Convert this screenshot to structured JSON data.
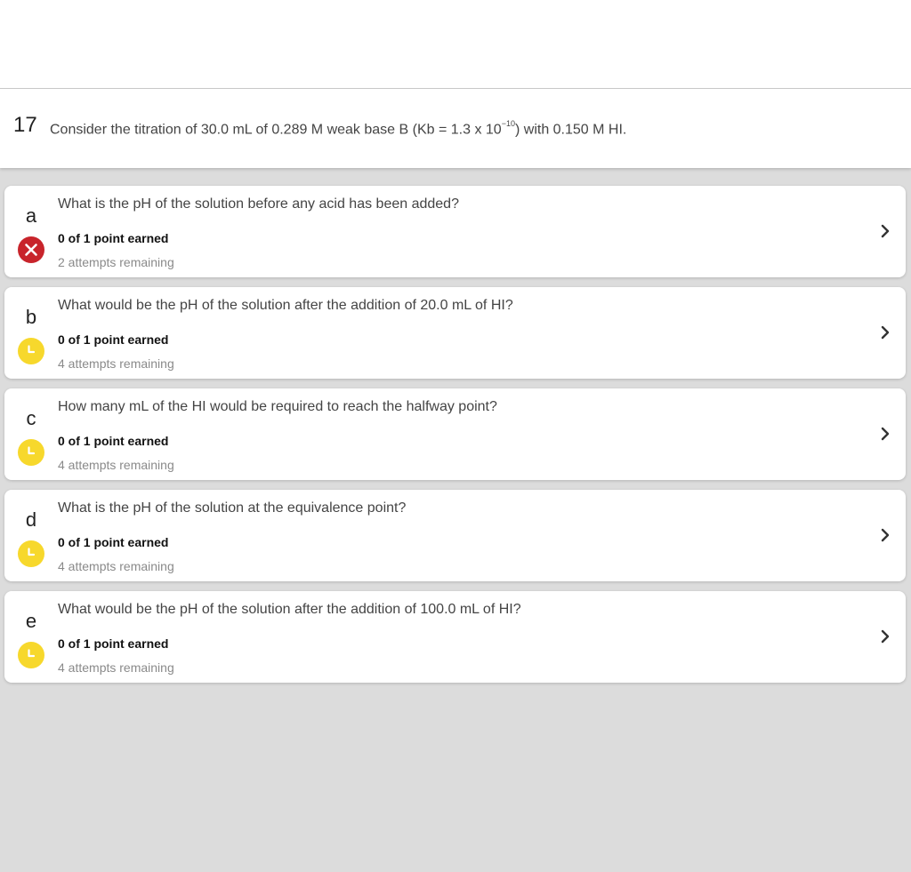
{
  "question": {
    "number": "17",
    "text_before": "Consider the titration of 30.0 mL of 0.289 M weak base B (Kb = 1.3 x 10",
    "exponent": "−10",
    "text_after": ") with 0.150 M HI."
  },
  "parts": [
    {
      "letter": "a",
      "question": "What is the pH of the solution before any acid has been added?",
      "points": "0 of 1 point earned",
      "attempts": "2 attempts remaining",
      "status_icon": "x-icon",
      "status_color": "#c8242b"
    },
    {
      "letter": "b",
      "question": "What would be the pH of the solution after the addition of 20.0 mL of HI?",
      "points": "0 of 1 point earned",
      "attempts": "4 attempts remaining",
      "status_icon": "clock-icon",
      "status_color": "#f7d82c"
    },
    {
      "letter": "c",
      "question": "How many mL of the HI would be required to reach the halfway point?",
      "points": "0 of 1 point earned",
      "attempts": "4 attempts remaining",
      "status_icon": "clock-icon",
      "status_color": "#f7d82c"
    },
    {
      "letter": "d",
      "question": "What is the pH of the solution at the equivalence point?",
      "points": "0 of 1 point earned",
      "attempts": "4 attempts remaining",
      "status_icon": "clock-icon",
      "status_color": "#f7d82c"
    },
    {
      "letter": "e",
      "question": "What would be the pH of the solution after the addition of 100.0 mL of HI?",
      "points": "0 of 1 point earned",
      "attempts": "4 attempts remaining",
      "status_icon": "clock-icon",
      "status_color": "#f7d82c"
    }
  ]
}
